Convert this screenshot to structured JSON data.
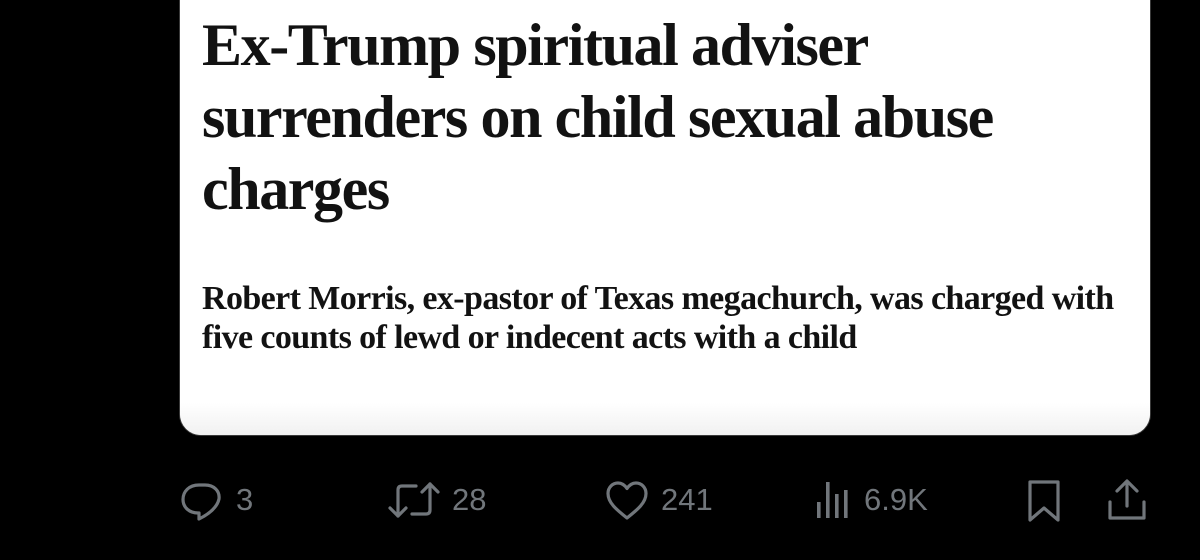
{
  "article": {
    "headline": "Ex-Trump spiritual adviser surrenders on child sexual abuse charges",
    "standfirst": "Robert Morris, ex-pastor of Texas megachurch, was charged with five counts of lewd or indecent acts with a child"
  },
  "actions": {
    "reply": {
      "icon": "speech-bubble-icon",
      "count": "3"
    },
    "repost": {
      "icon": "repost-arrows-icon",
      "count": "28"
    },
    "like": {
      "icon": "heart-icon",
      "count": "241"
    },
    "views": {
      "icon": "bar-chart-icon",
      "count": "6.9K"
    },
    "bookmark": {
      "icon": "bookmark-icon"
    },
    "share": {
      "icon": "share-upload-icon"
    }
  },
  "colors": {
    "background": "#000000",
    "card": "#ffffff",
    "text": "#121212",
    "icon": "#71767b"
  }
}
